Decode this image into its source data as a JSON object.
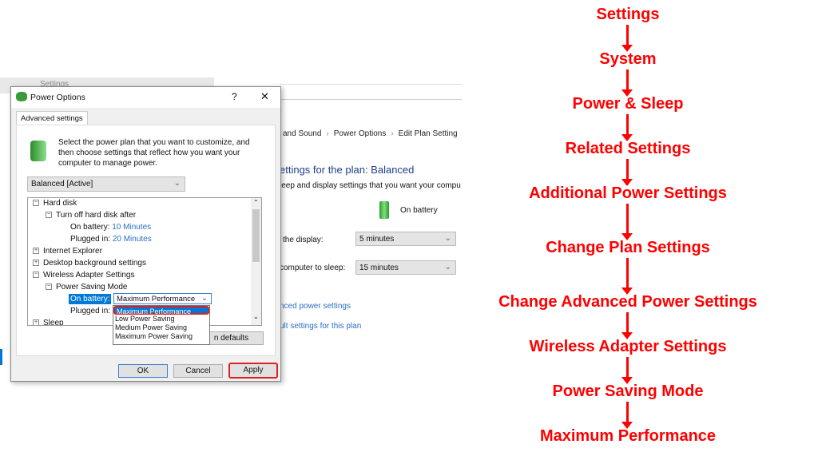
{
  "settings_window": {
    "title": "Settings"
  },
  "control_panel": {
    "breadcrumb": [
      "and Sound",
      "Power Options",
      "Edit Plan Setting"
    ],
    "title": "ettings for the plan: Balanced",
    "subtitle": "leep and display settings that you want your compu",
    "column": "On battery",
    "rows": [
      {
        "label": "the display:",
        "value": "5 minutes"
      },
      {
        "label": "computer to sleep:",
        "value": "15 minutes"
      }
    ],
    "links": [
      "nced power settings",
      "ult settings for this plan"
    ]
  },
  "dialog": {
    "title": "Power Options",
    "help": "?",
    "close": "✕",
    "tab": "Advanced settings",
    "description": "Select the power plan that you want to customize, and then choose settings that reflect how you want your computer to manage power.",
    "plan_select": "Balanced [Active]",
    "tree": {
      "hard_disk": "Hard disk",
      "turn_off": "Turn off hard disk after",
      "on_battery_label": "On battery:",
      "on_battery_value": "10 Minutes",
      "plugged_label": "Plugged in:",
      "plugged_value": "20 Minutes",
      "ie": "Internet Explorer",
      "desktop": "Desktop background settings",
      "wireless": "Wireless Adapter Settings",
      "psm": "Power Saving Mode",
      "wl_battery": "On battery:",
      "wl_battery_value": "Maximum Performance",
      "wl_plugged": "Plugged in:",
      "sleep": "Sleep"
    },
    "dropdown_options": [
      "Maximum Performance",
      "Low Power Saving",
      "Medium Power Saving",
      "Maximum Power Saving"
    ],
    "restore": "n defaults",
    "ok": "OK",
    "cancel": "Cancel",
    "apply": "Apply"
  },
  "flow_steps": [
    "Settings",
    "System",
    "Power & Sleep",
    "Related Settings",
    "Additional Power Settings",
    "Change Plan Settings",
    "Change Advanced Power Settings",
    "Wireless Adapter Settings",
    "Power Saving Mode",
    "Maximum Performance"
  ],
  "colors": {
    "highlight": "#ff0000",
    "link": "#2a6fc4",
    "selection": "#0078d7"
  }
}
